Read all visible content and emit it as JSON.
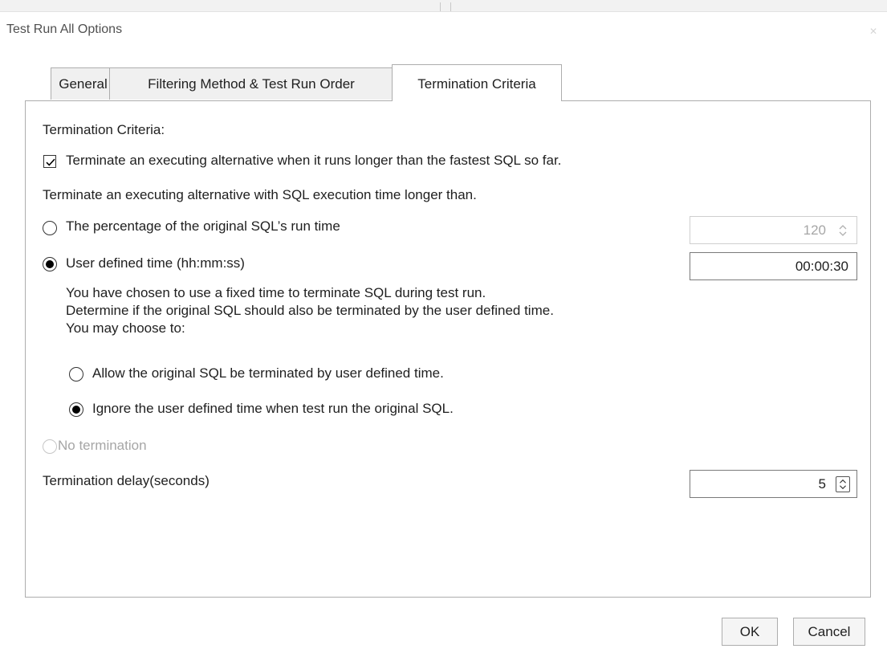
{
  "dialog": {
    "title": "Test Run All Options",
    "close_icon": "close-icon"
  },
  "tabs": [
    {
      "label": "General"
    },
    {
      "label": "Filtering Method & Test Run Order"
    },
    {
      "label": "Termination Criteria",
      "active": true
    }
  ],
  "termination": {
    "section_label": "Termination Criteria:",
    "checkbox_label": "Terminate an executing alternative when it runs longer than the fastest SQL so far.",
    "checkbox_checked": true,
    "intro": "Terminate an executing alternative with SQL execution time longer than.",
    "percentage_label": "The percentage of the original SQL’s run time",
    "percentage_value": "120",
    "user_defined_label": "User defined time (hh:mm:ss)",
    "user_defined_value": "00:00:30",
    "info_line1": "You have chosen to use a fixed time to terminate SQL during test run.",
    "info_line2": "Determine if the original SQL should also be terminated by the user defined time.",
    "info_line3": "You may choose to:",
    "allow_label": "Allow the original SQL be terminated by user defined time.",
    "ignore_label": "Ignore the user defined time when test run the original SQL.",
    "no_termination_label": "No termination",
    "delay_label": "Termination delay(seconds)",
    "delay_value": "5",
    "selected_mode": "User defined time (hh:mm:ss)",
    "selected_sub_option": "Ignore the user defined time when test run the original SQL."
  },
  "buttons": {
    "ok": "OK",
    "cancel": "Cancel"
  }
}
